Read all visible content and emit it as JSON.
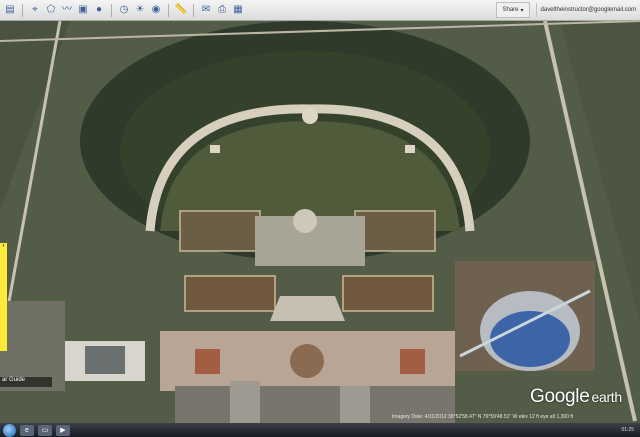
{
  "toolbar": {
    "icons": [
      "sidebar-toggle-icon",
      "placemark-icon",
      "polygon-icon",
      "path-icon",
      "image-overlay-icon",
      "record-tour-icon",
      "historical-imagery-icon",
      "sunlight-icon",
      "planets-icon",
      "ruler-icon",
      "email-icon",
      "print-icon",
      "view-in-maps-icon"
    ],
    "icon_glyphs": [
      "▤",
      "⌖",
      "⬠",
      "〰",
      "▣",
      "●",
      "◷",
      "☀",
      "◉",
      "📏",
      "✉",
      "⎙",
      "▦"
    ],
    "share_label": "Share",
    "account_email": "daveltheinstructor@googlemail.com"
  },
  "side_panel": {
    "tab_text": "ar Guide"
  },
  "status_bar": {
    "left_text": "ar Guide",
    "imagery_info": "Imagery Date: 4/11/2012   38°52'58.47\" N  76°59'48.51\" W  elev 12 ft   eye alt  1,300 ft"
  },
  "branding": {
    "logo_google": "Google",
    "logo_earth": "earth"
  },
  "taskbar": {
    "clock": "01:25",
    "items": [
      "ie-icon",
      "folder-icon",
      "media-icon"
    ],
    "item_glyphs": [
      "e",
      "▭",
      "▶"
    ]
  },
  "colors": {
    "ground": "#4d5a3f",
    "park": "#3a4a2c",
    "path": "#c9c2b0",
    "logo": "#ffffff",
    "tab_yellow": "#ffea3a"
  }
}
